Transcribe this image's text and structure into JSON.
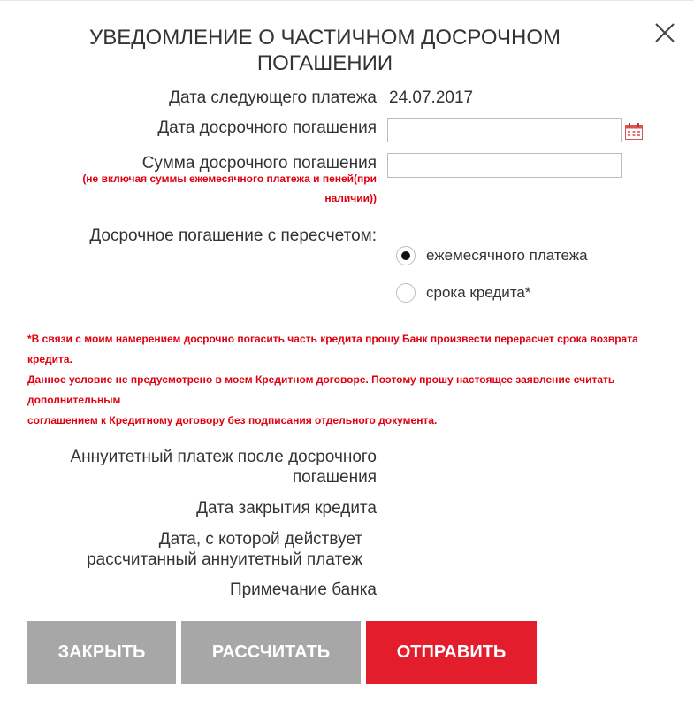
{
  "dialog": {
    "title_line1": "УВЕДОМЛЕНИЕ О ЧАСТИЧНОМ ДОСРОЧНОМ",
    "title_line2": "ПОГАШЕНИИ"
  },
  "form": {
    "next_payment_label": "Дата следующего платежа",
    "next_payment_value": "24.07.2017",
    "early_date_label": "Дата досрочного погашения",
    "early_date_value": "",
    "early_sum_label": "Сумма досрочного погашения",
    "early_sum_value": "",
    "early_sum_note_line1": "(не включая суммы ежемесячного платежа и пеней(при",
    "early_sum_note_line2": "наличии))",
    "recalc_label": "Досрочное погашение с пересчетом:",
    "recalc_options": [
      {
        "label": "ежемесячного платежа",
        "selected": true
      },
      {
        "label": "срока кредита*",
        "selected": false
      }
    ]
  },
  "disclaimer": [
    "*В связи с моим намерением досрочно погасить часть кредита прошу Банк произвести перерасчет срока возврата",
    "кредита.",
    "Данное условие не предусмотрено в моем Кредитном договоре. Поэтому прошу настоящее заявление считать",
    "дополнительным",
    "соглашением к Кредитному договору без подписания отдельного документа."
  ],
  "results": {
    "annuity_label_line1": "Аннуитетный платеж после досрочного",
    "annuity_label_line2": "погашения",
    "close_date_label": "Дата закрытия кредита",
    "effective_date_line1": "Дата, с которой действует",
    "effective_date_line2": "рассчитанный аннуитетный платеж",
    "bank_note_label": "Примечание банка"
  },
  "buttons": {
    "close": "ЗАКРЫТЬ",
    "calculate": "РАССЧИТАТЬ",
    "send": "ОТПРАВИТЬ"
  },
  "icons": {
    "close": "close-icon",
    "calendar": "calendar-icon"
  },
  "colors": {
    "accent_red": "#e41d2d",
    "note_red": "#e0000f",
    "button_gray": "#a7a7a7",
    "text": "#333333"
  }
}
